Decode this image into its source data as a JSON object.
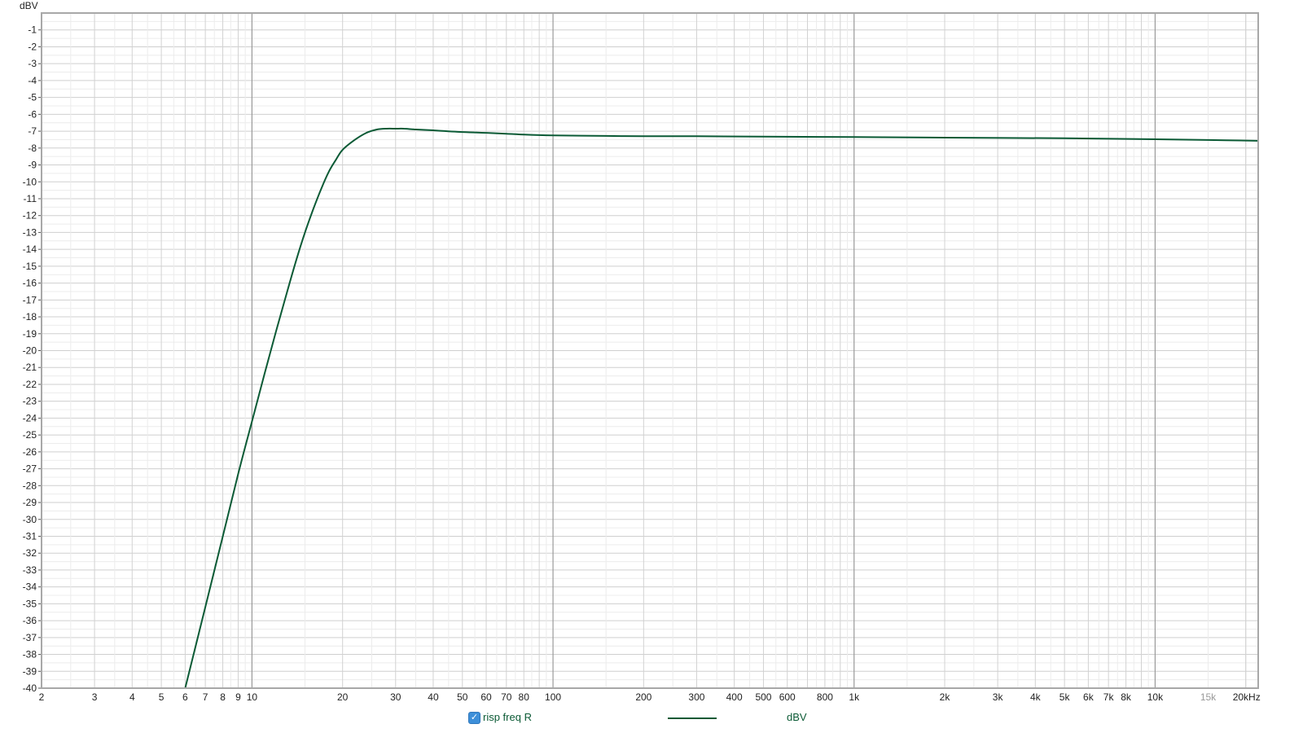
{
  "chart_data": {
    "type": "line",
    "ylabel": "dBV",
    "xscale": "log",
    "xlim": [
      2,
      22000
    ],
    "ylim": [
      -40,
      0
    ],
    "grid": true,
    "x_ticks": [
      {
        "value": 2,
        "label": "2"
      },
      {
        "value": 3,
        "label": "3"
      },
      {
        "value": 4,
        "label": "4"
      },
      {
        "value": 5,
        "label": "5"
      },
      {
        "value": 6,
        "label": "6"
      },
      {
        "value": 7,
        "label": "7"
      },
      {
        "value": 8,
        "label": "8"
      },
      {
        "value": 9,
        "label": "9"
      },
      {
        "value": 10,
        "label": "10"
      },
      {
        "value": 20,
        "label": "20"
      },
      {
        "value": 30,
        "label": "30"
      },
      {
        "value": 40,
        "label": "40"
      },
      {
        "value": 50,
        "label": "50"
      },
      {
        "value": 60,
        "label": "60"
      },
      {
        "value": 70,
        "label": "70"
      },
      {
        "value": 80,
        "label": "80"
      },
      {
        "value": 100,
        "label": "100"
      },
      {
        "value": 200,
        "label": "200"
      },
      {
        "value": 300,
        "label": "300"
      },
      {
        "value": 400,
        "label": "400"
      },
      {
        "value": 500,
        "label": "500"
      },
      {
        "value": 600,
        "label": "600"
      },
      {
        "value": 800,
        "label": "800"
      },
      {
        "value": 1000,
        "label": "1k"
      },
      {
        "value": 2000,
        "label": "2k"
      },
      {
        "value": 3000,
        "label": "3k"
      },
      {
        "value": 4000,
        "label": "4k"
      },
      {
        "value": 5000,
        "label": "5k"
      },
      {
        "value": 6000,
        "label": "6k"
      },
      {
        "value": 7000,
        "label": "7k"
      },
      {
        "value": 8000,
        "label": "8k"
      },
      {
        "value": 10000,
        "label": "10k"
      },
      {
        "value": 15000,
        "label": "15k",
        "dim": true
      },
      {
        "value": 20000,
        "label": "20kHz"
      }
    ],
    "y_ticks": [
      -1,
      -2,
      -3,
      -4,
      -5,
      -6,
      -7,
      -8,
      -9,
      -10,
      -11,
      -12,
      -13,
      -14,
      -15,
      -16,
      -17,
      -18,
      -19,
      -20,
      -21,
      -22,
      -23,
      -24,
      -25,
      -26,
      -27,
      -28,
      -29,
      -30,
      -31,
      -32,
      -33,
      -34,
      -35,
      -36,
      -37,
      -38,
      -39,
      -40
    ],
    "series": [
      {
        "name": "risp freq R",
        "unit": "dBV",
        "color": "#0b5a35",
        "x": [
          6,
          7,
          8,
          9,
          10,
          11,
          12,
          13,
          14,
          15,
          16,
          17,
          18,
          19,
          20,
          22,
          24,
          26,
          28,
          30,
          32,
          35,
          40,
          50,
          60,
          70,
          80,
          100,
          150,
          200,
          300,
          500,
          1000,
          2000,
          5000,
          10000,
          15000,
          22000
        ],
        "y": [
          -40,
          -35.2,
          -31.0,
          -27.3,
          -24.2,
          -21.4,
          -18.9,
          -16.7,
          -14.7,
          -13.0,
          -11.6,
          -10.4,
          -9.4,
          -8.7,
          -8.1,
          -7.5,
          -7.1,
          -6.9,
          -6.85,
          -6.85,
          -6.85,
          -6.9,
          -6.95,
          -7.05,
          -7.1,
          -7.15,
          -7.2,
          -7.25,
          -7.28,
          -7.3,
          -7.3,
          -7.32,
          -7.35,
          -7.38,
          -7.42,
          -7.48,
          -7.52,
          -7.57
        ]
      }
    ]
  },
  "legend": {
    "checked": true,
    "check_glyph": "✓",
    "label": "risp freq R",
    "unit": "dBV"
  }
}
